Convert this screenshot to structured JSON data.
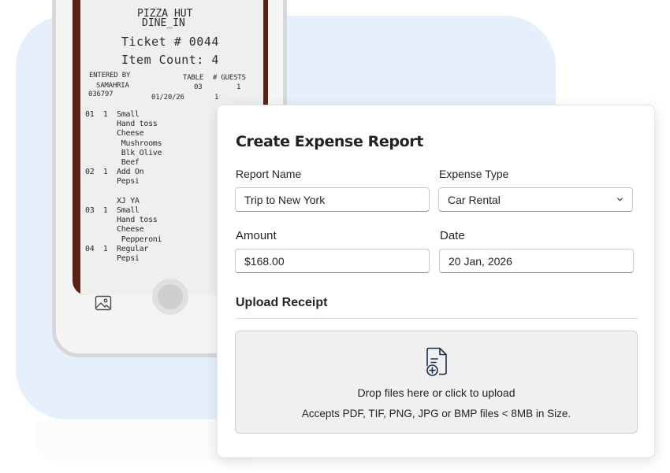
{
  "receipt": {
    "store": "PIZZA HUT",
    "mode": "DINE_IN",
    "ticket": "Ticket # 0044",
    "item_count": "Item Count: 4",
    "entered_by_label": "ENTERED BY",
    "table_label": "TABLE",
    "guests_label": "# GUESTS",
    "server": "SAMAHRIA",
    "table": "03",
    "guests": "1",
    "server_id": "036797",
    "date": "01/20/26",
    "extra_digit": "1",
    "items": [
      {
        "line": "01  1  Small"
      },
      {
        "line": "       Hand toss"
      },
      {
        "line": "       Cheese"
      },
      {
        "line": "        Mushrooms"
      },
      {
        "line": "        Blk Olive"
      },
      {
        "line": "        Beef"
      },
      {
        "line": "02  1  Add On"
      },
      {
        "line": "       Pepsi"
      },
      {
        "line": ""
      },
      {
        "line": "       XJ YA"
      },
      {
        "line": "03  1  Small"
      },
      {
        "line": "       Hand toss"
      },
      {
        "line": "       Cheese"
      },
      {
        "line": "        Pepperoni"
      },
      {
        "line": "04  1  Regular"
      },
      {
        "line": "       Pepsi"
      }
    ]
  },
  "dialog": {
    "title": "Create Expense Report",
    "report_name_label": "Report Name",
    "report_name_value": "Trip to New York",
    "expense_type_label": "Expense Type",
    "expense_type_value": "Car Rental",
    "amount_label": "Amount",
    "amount_value": "$168.00",
    "date_label": "Date",
    "date_value": "20 Jan, 2026",
    "upload_section": "Upload Receipt",
    "drop_text": "Drop files here or click to upload",
    "accept_text": "Accepts PDF, TIF, PNG, JPG or BMP files < 8MB in Size."
  },
  "icons": {
    "gallery": "image-icon",
    "home": "home-button",
    "select": "chevron-down-icon",
    "upload": "file-add-icon"
  },
  "colors": {
    "background_card": "#e6f0fd",
    "icon_navy": "#1b2e4b"
  }
}
